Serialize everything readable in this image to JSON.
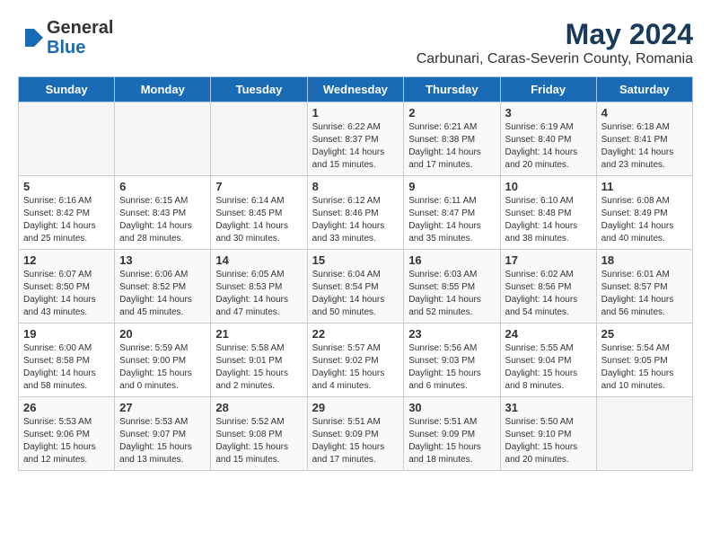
{
  "header": {
    "logo_general": "General",
    "logo_blue": "Blue",
    "title": "May 2024",
    "subtitle": "Carbunari, Caras-Severin County, Romania"
  },
  "days_of_week": [
    "Sunday",
    "Monday",
    "Tuesday",
    "Wednesday",
    "Thursday",
    "Friday",
    "Saturday"
  ],
  "weeks": [
    [
      {
        "day": "",
        "info": ""
      },
      {
        "day": "",
        "info": ""
      },
      {
        "day": "",
        "info": ""
      },
      {
        "day": "1",
        "info": "Sunrise: 6:22 AM\nSunset: 8:37 PM\nDaylight: 14 hours\nand 15 minutes."
      },
      {
        "day": "2",
        "info": "Sunrise: 6:21 AM\nSunset: 8:38 PM\nDaylight: 14 hours\nand 17 minutes."
      },
      {
        "day": "3",
        "info": "Sunrise: 6:19 AM\nSunset: 8:40 PM\nDaylight: 14 hours\nand 20 minutes."
      },
      {
        "day": "4",
        "info": "Sunrise: 6:18 AM\nSunset: 8:41 PM\nDaylight: 14 hours\nand 23 minutes."
      }
    ],
    [
      {
        "day": "5",
        "info": "Sunrise: 6:16 AM\nSunset: 8:42 PM\nDaylight: 14 hours\nand 25 minutes."
      },
      {
        "day": "6",
        "info": "Sunrise: 6:15 AM\nSunset: 8:43 PM\nDaylight: 14 hours\nand 28 minutes."
      },
      {
        "day": "7",
        "info": "Sunrise: 6:14 AM\nSunset: 8:45 PM\nDaylight: 14 hours\nand 30 minutes."
      },
      {
        "day": "8",
        "info": "Sunrise: 6:12 AM\nSunset: 8:46 PM\nDaylight: 14 hours\nand 33 minutes."
      },
      {
        "day": "9",
        "info": "Sunrise: 6:11 AM\nSunset: 8:47 PM\nDaylight: 14 hours\nand 35 minutes."
      },
      {
        "day": "10",
        "info": "Sunrise: 6:10 AM\nSunset: 8:48 PM\nDaylight: 14 hours\nand 38 minutes."
      },
      {
        "day": "11",
        "info": "Sunrise: 6:08 AM\nSunset: 8:49 PM\nDaylight: 14 hours\nand 40 minutes."
      }
    ],
    [
      {
        "day": "12",
        "info": "Sunrise: 6:07 AM\nSunset: 8:50 PM\nDaylight: 14 hours\nand 43 minutes."
      },
      {
        "day": "13",
        "info": "Sunrise: 6:06 AM\nSunset: 8:52 PM\nDaylight: 14 hours\nand 45 minutes."
      },
      {
        "day": "14",
        "info": "Sunrise: 6:05 AM\nSunset: 8:53 PM\nDaylight: 14 hours\nand 47 minutes."
      },
      {
        "day": "15",
        "info": "Sunrise: 6:04 AM\nSunset: 8:54 PM\nDaylight: 14 hours\nand 50 minutes."
      },
      {
        "day": "16",
        "info": "Sunrise: 6:03 AM\nSunset: 8:55 PM\nDaylight: 14 hours\nand 52 minutes."
      },
      {
        "day": "17",
        "info": "Sunrise: 6:02 AM\nSunset: 8:56 PM\nDaylight: 14 hours\nand 54 minutes."
      },
      {
        "day": "18",
        "info": "Sunrise: 6:01 AM\nSunset: 8:57 PM\nDaylight: 14 hours\nand 56 minutes."
      }
    ],
    [
      {
        "day": "19",
        "info": "Sunrise: 6:00 AM\nSunset: 8:58 PM\nDaylight: 14 hours\nand 58 minutes."
      },
      {
        "day": "20",
        "info": "Sunrise: 5:59 AM\nSunset: 9:00 PM\nDaylight: 15 hours\nand 0 minutes."
      },
      {
        "day": "21",
        "info": "Sunrise: 5:58 AM\nSunset: 9:01 PM\nDaylight: 15 hours\nand 2 minutes."
      },
      {
        "day": "22",
        "info": "Sunrise: 5:57 AM\nSunset: 9:02 PM\nDaylight: 15 hours\nand 4 minutes."
      },
      {
        "day": "23",
        "info": "Sunrise: 5:56 AM\nSunset: 9:03 PM\nDaylight: 15 hours\nand 6 minutes."
      },
      {
        "day": "24",
        "info": "Sunrise: 5:55 AM\nSunset: 9:04 PM\nDaylight: 15 hours\nand 8 minutes."
      },
      {
        "day": "25",
        "info": "Sunrise: 5:54 AM\nSunset: 9:05 PM\nDaylight: 15 hours\nand 10 minutes."
      }
    ],
    [
      {
        "day": "26",
        "info": "Sunrise: 5:53 AM\nSunset: 9:06 PM\nDaylight: 15 hours\nand 12 minutes."
      },
      {
        "day": "27",
        "info": "Sunrise: 5:53 AM\nSunset: 9:07 PM\nDaylight: 15 hours\nand 13 minutes."
      },
      {
        "day": "28",
        "info": "Sunrise: 5:52 AM\nSunset: 9:08 PM\nDaylight: 15 hours\nand 15 minutes."
      },
      {
        "day": "29",
        "info": "Sunrise: 5:51 AM\nSunset: 9:09 PM\nDaylight: 15 hours\nand 17 minutes."
      },
      {
        "day": "30",
        "info": "Sunrise: 5:51 AM\nSunset: 9:09 PM\nDaylight: 15 hours\nand 18 minutes."
      },
      {
        "day": "31",
        "info": "Sunrise: 5:50 AM\nSunset: 9:10 PM\nDaylight: 15 hours\nand 20 minutes."
      },
      {
        "day": "",
        "info": ""
      }
    ]
  ]
}
